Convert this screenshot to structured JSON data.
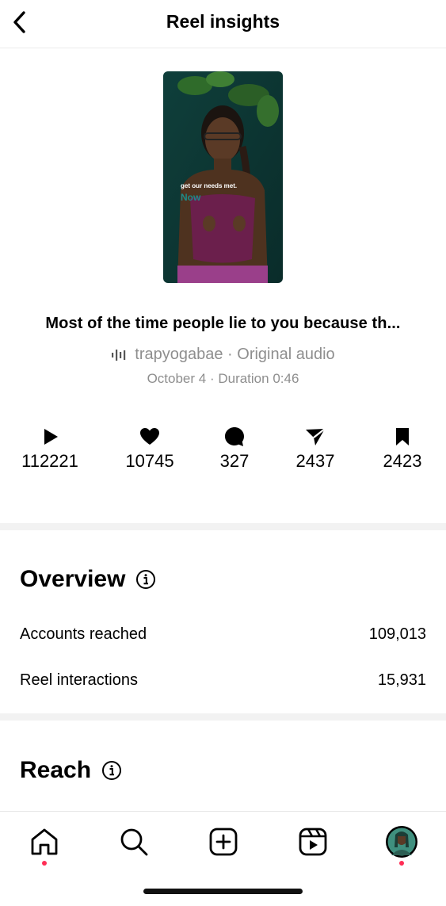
{
  "header": {
    "title": "Reel insights"
  },
  "reel": {
    "overlay_line1": "get our needs met.",
    "overlay_line2": "Now",
    "caption": "Most of the time people lie to you because th...",
    "audio": "trapyogabae · Original audio",
    "meta": "October 4 · Duration 0:46"
  },
  "stats": [
    {
      "icon": "play-icon",
      "value": "112221"
    },
    {
      "icon": "heart-icon",
      "value": "10745"
    },
    {
      "icon": "comment-icon",
      "value": "327"
    },
    {
      "icon": "share-icon",
      "value": "2437"
    },
    {
      "icon": "bookmark-icon",
      "value": "2423"
    }
  ],
  "overview": {
    "title": "Overview",
    "rows": [
      {
        "label": "Accounts reached",
        "value": "109,013"
      },
      {
        "label": "Reel interactions",
        "value": "15,931"
      }
    ]
  },
  "reach": {
    "title": "Reach"
  },
  "tabbar": {
    "items": [
      "home-icon",
      "search-icon",
      "create-icon",
      "reels-icon",
      "profile-avatar"
    ],
    "notification_color": "#ff2d55"
  }
}
